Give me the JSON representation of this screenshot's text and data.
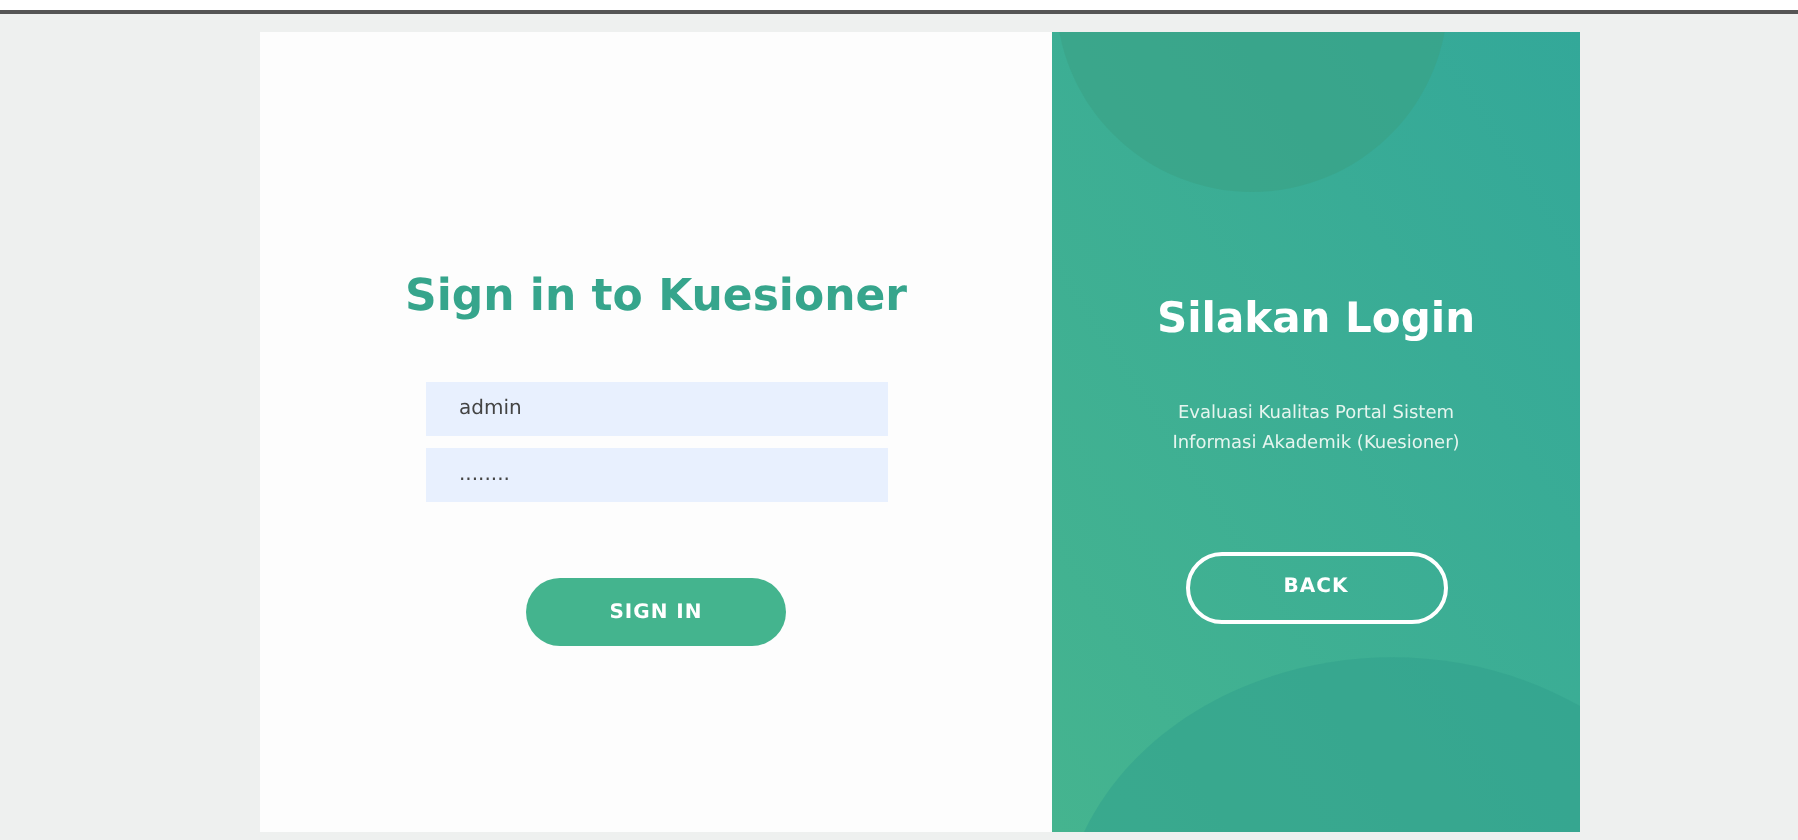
{
  "sign_in": {
    "title": "Sign in to Kuesioner",
    "fields": [
      {
        "value": "admin"
      },
      {
        "value": "........"
      }
    ],
    "button": "SIGN IN"
  },
  "welcome": {
    "title": "Silakan Login",
    "subtitle": "Evaluasi Kualitas Portal Sistem Informasi Akademik (Kuesioner)",
    "button": "BACK"
  }
}
